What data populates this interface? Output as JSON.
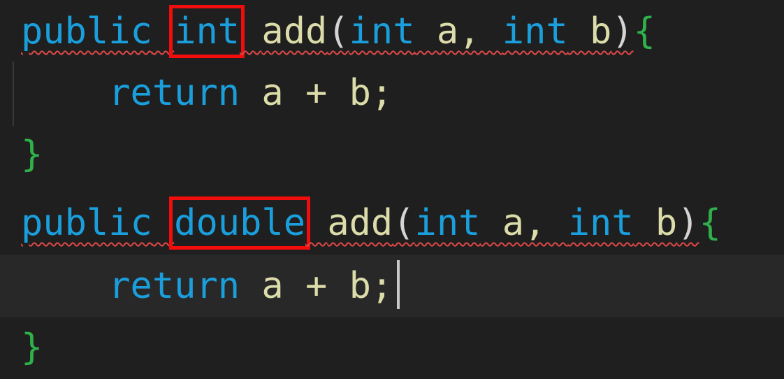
{
  "code": {
    "lines": [
      {
        "tokens": {
          "t0": "public",
          "t1": " ",
          "t2": "int",
          "t3": " ",
          "t4": "add",
          "t5": "(",
          "t6": "int",
          "t7": " a, ",
          "t8": "int",
          "t9": " b",
          "t10": ")",
          "t11": "{"
        }
      },
      {
        "tokens": {
          "t0": "    ",
          "t1": "return",
          "t2": " a + b;"
        }
      },
      {
        "tokens": {
          "t0": "}"
        }
      },
      {
        "tokens": {
          "t0": "public",
          "t1": " ",
          "t2": "double",
          "t3": " ",
          "t4": "add",
          "t5": "(",
          "t6": "int",
          "t7": " a, ",
          "t8": "int",
          "t9": " b",
          "t10": ")",
          "t11": "{"
        }
      },
      {
        "tokens": {
          "t0": "    ",
          "t1": "return",
          "t2": " a + b;"
        }
      },
      {
        "tokens": {
          "t0": "}"
        }
      }
    ]
  },
  "colors": {
    "background": "#1f1f1f",
    "keyword": "#1a9fdc",
    "function": "#dcdcaa",
    "brace": "#2fb04a",
    "plain": "#d4d4d4",
    "error_squiggle": "#e04848",
    "highlight_box": "#f20d0d",
    "current_line": "#282828"
  }
}
